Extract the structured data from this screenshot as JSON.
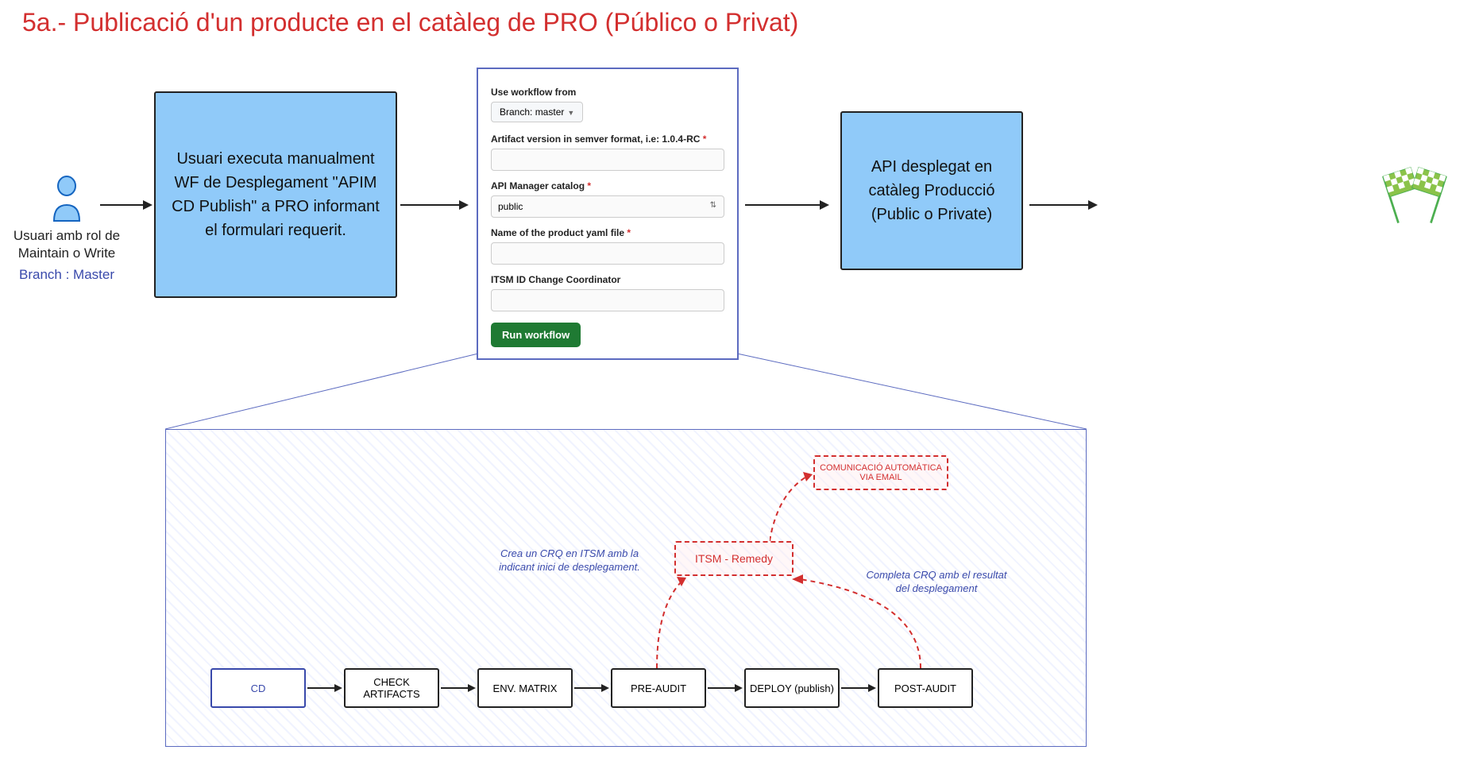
{
  "title": "5a.- Publicació d'un producte en el catàleg de PRO (Público o Privat)",
  "actor": {
    "label": "Usuari amb rol de Maintain o Write",
    "branch": "Branch : Master"
  },
  "box1": "Usuari executa manualment WF de Desplegament \"APIM CD Publish\" a PRO informant el formulari requerit.",
  "box3": "API desplegat en catàleg Producció (Public o Private)",
  "form": {
    "use_workflow": "Use workflow from",
    "branch_dd": "Branch: master",
    "artifact_label": "Artifact version in semver format, i.e: 1.0.4-RC",
    "catalog_label": "API Manager catalog",
    "catalog_value": "public",
    "yaml_label": "Name of the product yaml file",
    "itsm_label": "ITSM ID Change Coordinator",
    "run_btn": "Run workflow"
  },
  "steps": {
    "cd": "CD",
    "check": "CHECK ARTIFACTS",
    "env": "ENV. MATRIX",
    "preaudit": "PRE-AUDIT",
    "deploy": "DEPLOY (publish)",
    "postaudit": "POST-AUDIT"
  },
  "dashed": {
    "itsm": "ITSM - Remedy",
    "email": "COMUNICACIÓ AUTOMÀTICA VIA EMAIL"
  },
  "notes": {
    "crea": "Crea un CRQ en ITSM amb la indicant inici de desplegament.",
    "completa": "Completa CRQ amb el resultat del desplegament"
  }
}
